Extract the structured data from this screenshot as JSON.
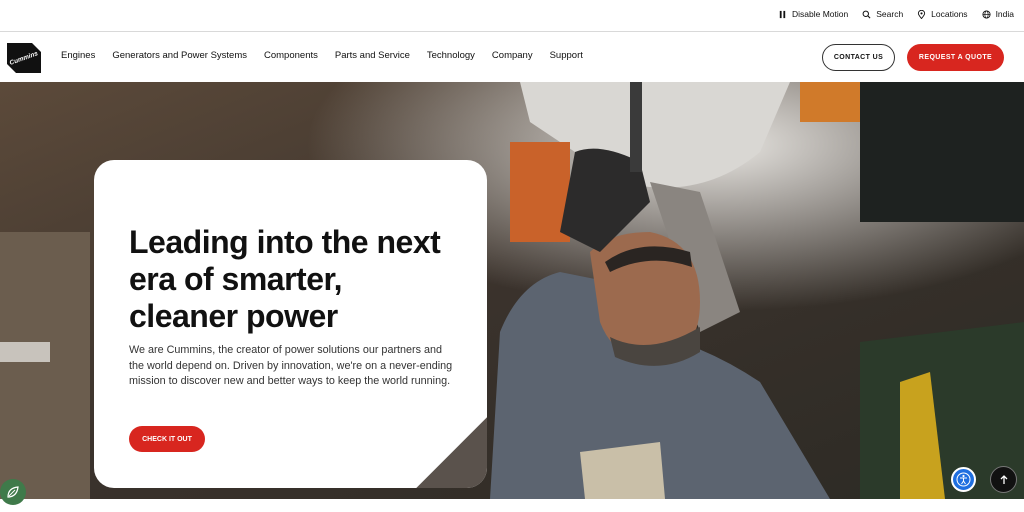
{
  "utility": {
    "disable_motion": "Disable Motion",
    "search": "Search",
    "locations": "Locations",
    "region": "India"
  },
  "brand": {
    "logo_text": "Cummins",
    "accent": "#d8261f"
  },
  "nav": {
    "items": [
      "Engines",
      "Generators and Power Systems",
      "Components",
      "Parts and Service",
      "Technology",
      "Company",
      "Support"
    ],
    "contact": "CONTACT US",
    "quote": "REQUEST A QUOTE"
  },
  "hero": {
    "title_lines": [
      "Leading into the next",
      "era of smarter,",
      "cleaner power"
    ],
    "description": "We are Cummins, the creator of power solutions our partners and the world depend on. Driven by innovation, we're on a never-ending mission to discover new and better ways to keep the world running.",
    "cta": "CHECK IT OUT"
  },
  "icons": {
    "disable_motion": "pause-icon",
    "search": "search-icon",
    "locations": "location-pin-icon",
    "region": "globe-icon",
    "accessibility": "accessibility-icon",
    "back_to_top": "arrow-up-icon",
    "eco": "leaf-icon"
  }
}
